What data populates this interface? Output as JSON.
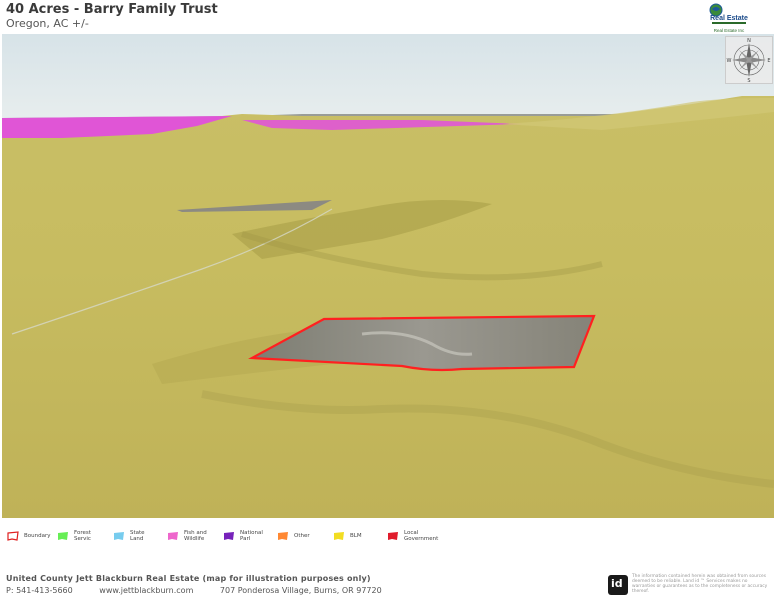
{
  "header": {
    "title": "40 Acres - Barry Family Trust",
    "subtitle": "Oregon,  AC +/-"
  },
  "logo": {
    "line1": "Real Estate",
    "line2": "Real Estate Inc"
  },
  "compass": {
    "n": "N",
    "s": "S",
    "e": "E",
    "w": "W"
  },
  "legend": [
    {
      "label": "Boundary",
      "color": "#e02020",
      "style": "outline"
    },
    {
      "label": "Forest Servic",
      "color": "#66ee55",
      "style": "fill"
    },
    {
      "label": "State Land",
      "color": "#77ccee",
      "style": "fill"
    },
    {
      "label": "Fish and Wildlife",
      "color": "#ee66cc",
      "style": "fill"
    },
    {
      "label": "National Parl",
      "color": "#7722bb",
      "style": "fill"
    },
    {
      "label": "Other",
      "color": "#ff8833",
      "style": "fill"
    },
    {
      "label": "BLM",
      "color": "#f2dd22",
      "style": "fill"
    },
    {
      "label": "Local Government",
      "color": "#e01c2c",
      "style": "fill"
    }
  ],
  "map_colors": {
    "sky": "#dfe8ea",
    "terrain": "#c8bd5e",
    "fish_wildlife": "#e055d6",
    "boundary": "#ff2020",
    "parcel": "#8a8a80"
  },
  "footer": {
    "company": "United County Jett Blackburn Real Estate  (map for illustration purposes only)",
    "phone": "P: 541-413-5660",
    "website": "www.jettblackburn.com",
    "address": "707 Ponderosa Village, Burns, OR 97720",
    "id_logo": "id",
    "disclaimer": "The information contained herein was obtained from sources deemed to be reliable. Land id ™ Services makes no warranties or guarantees as to the completeness or accuracy thereof."
  }
}
